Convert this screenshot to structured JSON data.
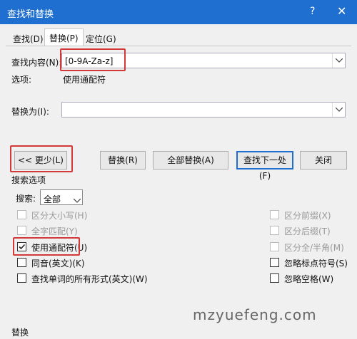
{
  "window": {
    "title": "查找和替换",
    "help": "?",
    "close": "✕"
  },
  "tabs": [
    {
      "label": "查找(D)"
    },
    {
      "label": "替换(P)"
    },
    {
      "label": "定位(G)"
    }
  ],
  "find": {
    "label": "查找内容(N):",
    "value": "[0-9A-Za-z]"
  },
  "options": {
    "label": "选项:",
    "value": "使用通配符"
  },
  "replace": {
    "label": "替换为(I):",
    "value": ""
  },
  "buttons": {
    "less": "<< 更少(L)",
    "replace": "替换(R)",
    "replace_all": "全部替换(A)",
    "find_next": "查找下一处(F)",
    "close": "关闭"
  },
  "search_options": {
    "title": "搜索选项",
    "search_label": "搜索:",
    "search_value": "全部",
    "left": [
      {
        "label": "区分大小写(H)",
        "checked": false,
        "disabled": true
      },
      {
        "label": "全字匹配(Y)",
        "checked": false,
        "disabled": true
      },
      {
        "label": "使用通配符(U)",
        "checked": true,
        "disabled": false
      },
      {
        "label": "同音(英文)(K)",
        "checked": false,
        "disabled": false
      },
      {
        "label": "查找单词的所有形式(英文)(W)",
        "checked": false,
        "disabled": false
      }
    ],
    "right": [
      {
        "label": "区分前缀(X)",
        "checked": false,
        "disabled": true
      },
      {
        "label": "区分后缀(T)",
        "checked": false,
        "disabled": true
      },
      {
        "label": "区分全/半角(M)",
        "checked": false,
        "disabled": true
      },
      {
        "label": "忽略标点符号(S)",
        "checked": false,
        "disabled": false
      },
      {
        "label": "忽略空格(W)",
        "checked": false,
        "disabled": false
      }
    ]
  },
  "replace_section": {
    "title": "替换"
  },
  "watermark": "mzyuefeng.com"
}
